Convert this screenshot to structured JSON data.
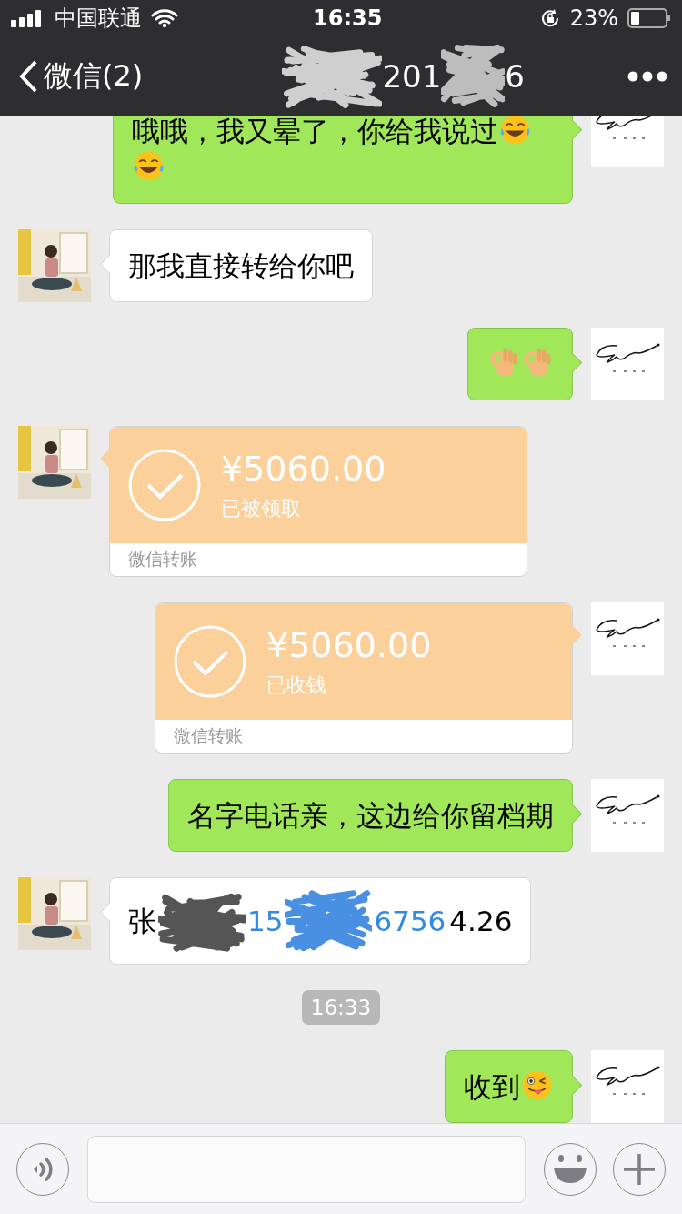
{
  "status_bar": {
    "carrier": "中国联通",
    "time": "16:35",
    "battery": "23%"
  },
  "nav": {
    "back_label": "微信(2)",
    "title_fragments": [
      "201",
      "6"
    ]
  },
  "messages": [
    {
      "kind": "text",
      "outgoing": true,
      "text": "哦哦，我又晕了，你给我说过",
      "emojis": [
        {
          "kind": "laughing-tears"
        },
        {
          "kind": "laughing-tears"
        }
      ]
    },
    {
      "kind": "text",
      "outgoing": false,
      "text": "那我直接转给你吧"
    },
    {
      "kind": "text",
      "outgoing": true,
      "emojis": [
        {
          "kind": "ok-hand"
        },
        {
          "kind": "ok-hand"
        }
      ]
    },
    {
      "kind": "transfer",
      "outgoing": false,
      "amount": "¥5060.00",
      "status": "已被领取",
      "label": "微信转账"
    },
    {
      "kind": "transfer",
      "outgoing": true,
      "amount": "¥5060.00",
      "status": "已收钱",
      "label": "微信转账"
    },
    {
      "kind": "text",
      "outgoing": true,
      "text": "名字电话亲，这边给你留档期"
    },
    {
      "kind": "redacted",
      "outgoing": false,
      "fragments": [
        {
          "kind": "plain",
          "text": "张"
        },
        {
          "kind": "redaction",
          "color": "#555555"
        },
        {
          "kind": "link",
          "text": "15"
        },
        {
          "kind": "redaction",
          "color": "#4a90e2"
        },
        {
          "kind": "link",
          "text": "6756"
        },
        {
          "kind": "plain",
          "text": "4.26"
        }
      ]
    },
    {
      "kind": "time",
      "text": "16:33"
    },
    {
      "kind": "text",
      "outgoing": true,
      "text": "收到",
      "emojis": [
        {
          "kind": "winking-tongue"
        }
      ]
    }
  ]
}
